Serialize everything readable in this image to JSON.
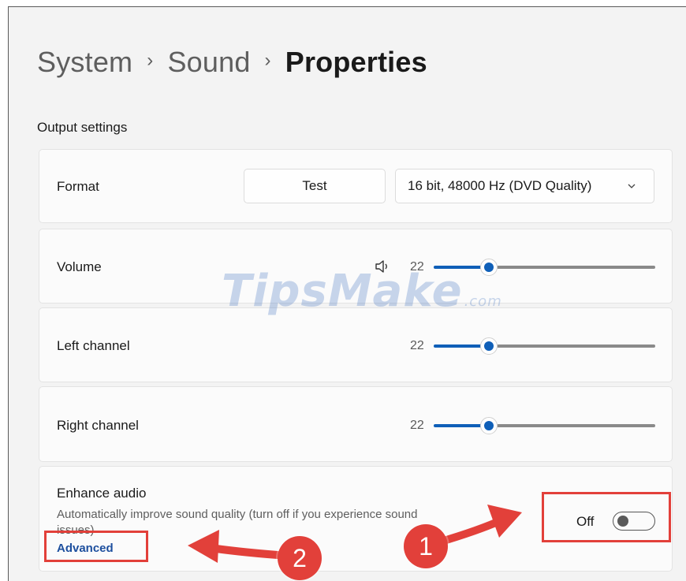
{
  "breadcrumb": {
    "items": [
      "System",
      "Sound"
    ],
    "current": "Properties",
    "separator": "›"
  },
  "output_settings": {
    "title": "Output settings",
    "format": {
      "label": "Format",
      "test_button": "Test",
      "dropdown_value": "16 bit, 48000 Hz (DVD Quality)"
    },
    "volume": {
      "label": "Volume",
      "value": "22",
      "level": 0.22
    },
    "left_channel": {
      "label": "Left channel",
      "value": "22",
      "level": 0.22
    },
    "right_channel": {
      "label": "Right channel",
      "value": "22",
      "level": 0.22
    }
  },
  "enhance_audio": {
    "title": "Enhance audio",
    "description": "Automatically improve sound quality (turn off if you experience sound issues)",
    "link": "Advanced",
    "toggle_label": "Off",
    "toggle_on": false
  },
  "annotations": {
    "badge_1": "1",
    "badge_2": "2",
    "color": "#e2403a"
  },
  "watermark": {
    "text": "TipsMake",
    "suffix": ".com"
  },
  "colors": {
    "accent": "#0f5fb8",
    "link": "#1d4f9e",
    "background": "#f3f3f3"
  },
  "icons": [
    "speaker-icon",
    "chevron-down-icon"
  ]
}
